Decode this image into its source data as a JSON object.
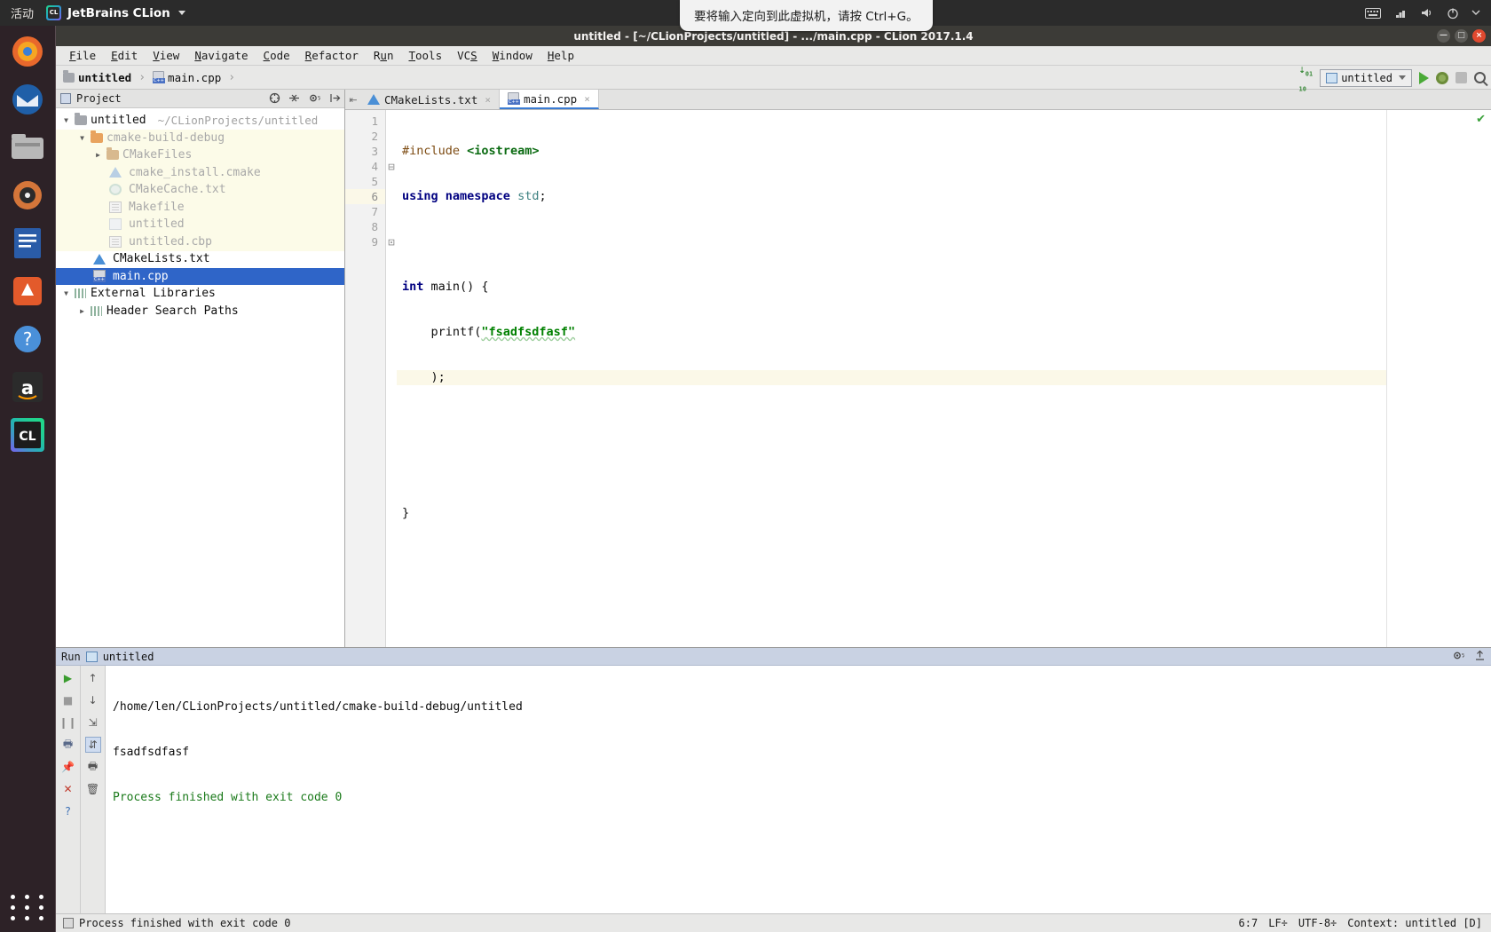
{
  "gnome": {
    "activities": "活动",
    "app_name": "JetBrains CLion",
    "app_icon": "clion-icon",
    "caret_icon": "chevron-down-icon",
    "tray": [
      "keyboard-icon",
      "network-icon",
      "volume-icon",
      "power-icon",
      "chevron-down-icon"
    ]
  },
  "vm_tooltip": {
    "text": "要将输入定向到此虚拟机，请按 Ctrl+G。"
  },
  "dock": {
    "items": [
      {
        "name": "firefox",
        "glyph": "🦊",
        "color": "#e8682c"
      },
      {
        "name": "thunderbird",
        "glyph": "✉",
        "color": "#1f7cc4"
      },
      {
        "name": "files",
        "glyph": "🗄",
        "color": "#8e8e8e"
      },
      {
        "name": "rhythmbox",
        "glyph": "◉",
        "color": "#d5763a"
      },
      {
        "name": "libreoffice-writer",
        "glyph": "📘",
        "color": "#2a5ca8"
      },
      {
        "name": "ubuntu-software",
        "glyph": "🅰",
        "color": "#e35a2b"
      },
      {
        "name": "help",
        "glyph": "?",
        "color": "#4a90d9"
      },
      {
        "name": "amazon",
        "glyph": "a",
        "color": "#ffffff"
      },
      {
        "name": "clion",
        "glyph": "CL",
        "color": "#21d789"
      }
    ],
    "show_apps_label": "show-applications"
  },
  "window": {
    "title": "untitled - [~/CLionProjects/untitled] - .../main.cpp - CLion 2017.1.4",
    "buttons": [
      "minimize",
      "maximize",
      "close"
    ]
  },
  "menubar": {
    "items": [
      {
        "label": "File",
        "mnemonic": "F"
      },
      {
        "label": "Edit",
        "mnemonic": "E"
      },
      {
        "label": "View",
        "mnemonic": "V"
      },
      {
        "label": "Navigate",
        "mnemonic": "N"
      },
      {
        "label": "Code",
        "mnemonic": "C"
      },
      {
        "label": "Refactor",
        "mnemonic": "R"
      },
      {
        "label": "Run",
        "mnemonic": "u"
      },
      {
        "label": "Tools",
        "mnemonic": "T"
      },
      {
        "label": "VCS",
        "mnemonic": "S"
      },
      {
        "label": "Window",
        "mnemonic": "W"
      },
      {
        "label": "Help",
        "mnemonic": "H"
      }
    ]
  },
  "navbar": {
    "breadcrumb": [
      {
        "label": "untitled",
        "icon": "folder-icon"
      },
      {
        "label": "main.cpp",
        "icon": "cpp-file-icon"
      }
    ],
    "separator": "›",
    "run_config": "untitled",
    "run_config_icon": "app-icon",
    "buttons": [
      "download-updates-icon",
      "run-icon",
      "debug-icon",
      "stop-icon",
      "search-everywhere-icon"
    ]
  },
  "project_panel": {
    "title": "Project",
    "header_icons": [
      "collapse-target-icon",
      "collapse-all-icon",
      "gear-icon",
      "hide-icon"
    ],
    "tree": [
      {
        "label": "untitled",
        "path": "~/CLionProjects/untitled",
        "depth": 0,
        "arrow": "down",
        "icon": "folder",
        "state": "normal"
      },
      {
        "label": "cmake-build-debug",
        "path": "",
        "depth": 1,
        "arrow": "down",
        "icon": "folder-orange",
        "state": "excluded"
      },
      {
        "label": "CMakeFiles",
        "path": "",
        "depth": 2,
        "arrow": "right",
        "icon": "folder-pale",
        "state": "excluded"
      },
      {
        "label": "cmake_install.cmake",
        "path": "",
        "depth": 3,
        "arrow": "none",
        "icon": "cmake",
        "state": "excluded"
      },
      {
        "label": "CMakeCache.txt",
        "path": "",
        "depth": 3,
        "arrow": "none",
        "icon": "gear",
        "state": "excluded"
      },
      {
        "label": "Makefile",
        "path": "",
        "depth": 3,
        "arrow": "none",
        "icon": "txt",
        "state": "excluded"
      },
      {
        "label": "untitled",
        "path": "",
        "depth": 3,
        "arrow": "none",
        "icon": "bin",
        "state": "excluded"
      },
      {
        "label": "untitled.cbp",
        "path": "",
        "depth": 3,
        "arrow": "none",
        "icon": "txt",
        "state": "excluded"
      },
      {
        "label": "CMakeLists.txt",
        "path": "",
        "depth": 1,
        "arrow": "none",
        "icon": "cmake",
        "state": "normal"
      },
      {
        "label": "main.cpp",
        "path": "",
        "depth": 1,
        "arrow": "none",
        "icon": "cpp",
        "state": "selected"
      },
      {
        "label": "External Libraries",
        "path": "",
        "depth": 0,
        "arrow": "down",
        "icon": "lib",
        "state": "normal"
      },
      {
        "label": "Header Search Paths",
        "path": "",
        "depth": 1,
        "arrow": "right",
        "icon": "lib",
        "state": "normal"
      }
    ]
  },
  "editor": {
    "tabs": [
      {
        "label": "CMakeLists.txt",
        "icon": "cmake-icon",
        "active": false,
        "close": "×"
      },
      {
        "label": "main.cpp",
        "icon": "cpp-file-icon",
        "active": true,
        "close": "×"
      }
    ],
    "line_numbers": [
      "1",
      "2",
      "3",
      "4",
      "5",
      "6",
      "7",
      "8",
      "9"
    ],
    "current_line": 6,
    "lines": [
      "#include <iostream>",
      "using namespace std;",
      "",
      "int main() {",
      "    printf(\"fsadfsdfasf\"",
      "    );",
      "",
      "",
      "}"
    ],
    "fold_markers": {
      "4": "⊖",
      "9": "⊖"
    },
    "inspection_status": "ok-check-icon"
  },
  "run_panel": {
    "title": "Run",
    "config_name": "untitled",
    "config_icon": "app-icon",
    "header_icons": [
      "gear-icon",
      "hide-icon"
    ],
    "tool_buttons_left": [
      "rerun-icon",
      "stop-icon",
      "pause-icon",
      "print-icon",
      "pin-icon",
      "close-icon",
      "help-icon"
    ],
    "tool_buttons_right": [
      "up-arrow-icon",
      "down-arrow-icon",
      "soft-wrap-icon",
      "scroll-to-end-icon",
      "print-icon",
      "trash-icon"
    ],
    "console_lines": [
      {
        "text": "/home/len/CLionProjects/untitled/cmake-build-debug/untitled",
        "style": "normal"
      },
      {
        "text": "fsadfsdfasf",
        "style": "normal"
      },
      {
        "text": "Process finished with exit code 0",
        "style": "ok"
      }
    ]
  },
  "statusbar": {
    "message": "Process finished with exit code 0",
    "message_icon": "console-icon",
    "caret_position": "6:7",
    "line_separator": "LF÷",
    "encoding": "UTF-8÷",
    "context": "Context: untitled [D]"
  }
}
